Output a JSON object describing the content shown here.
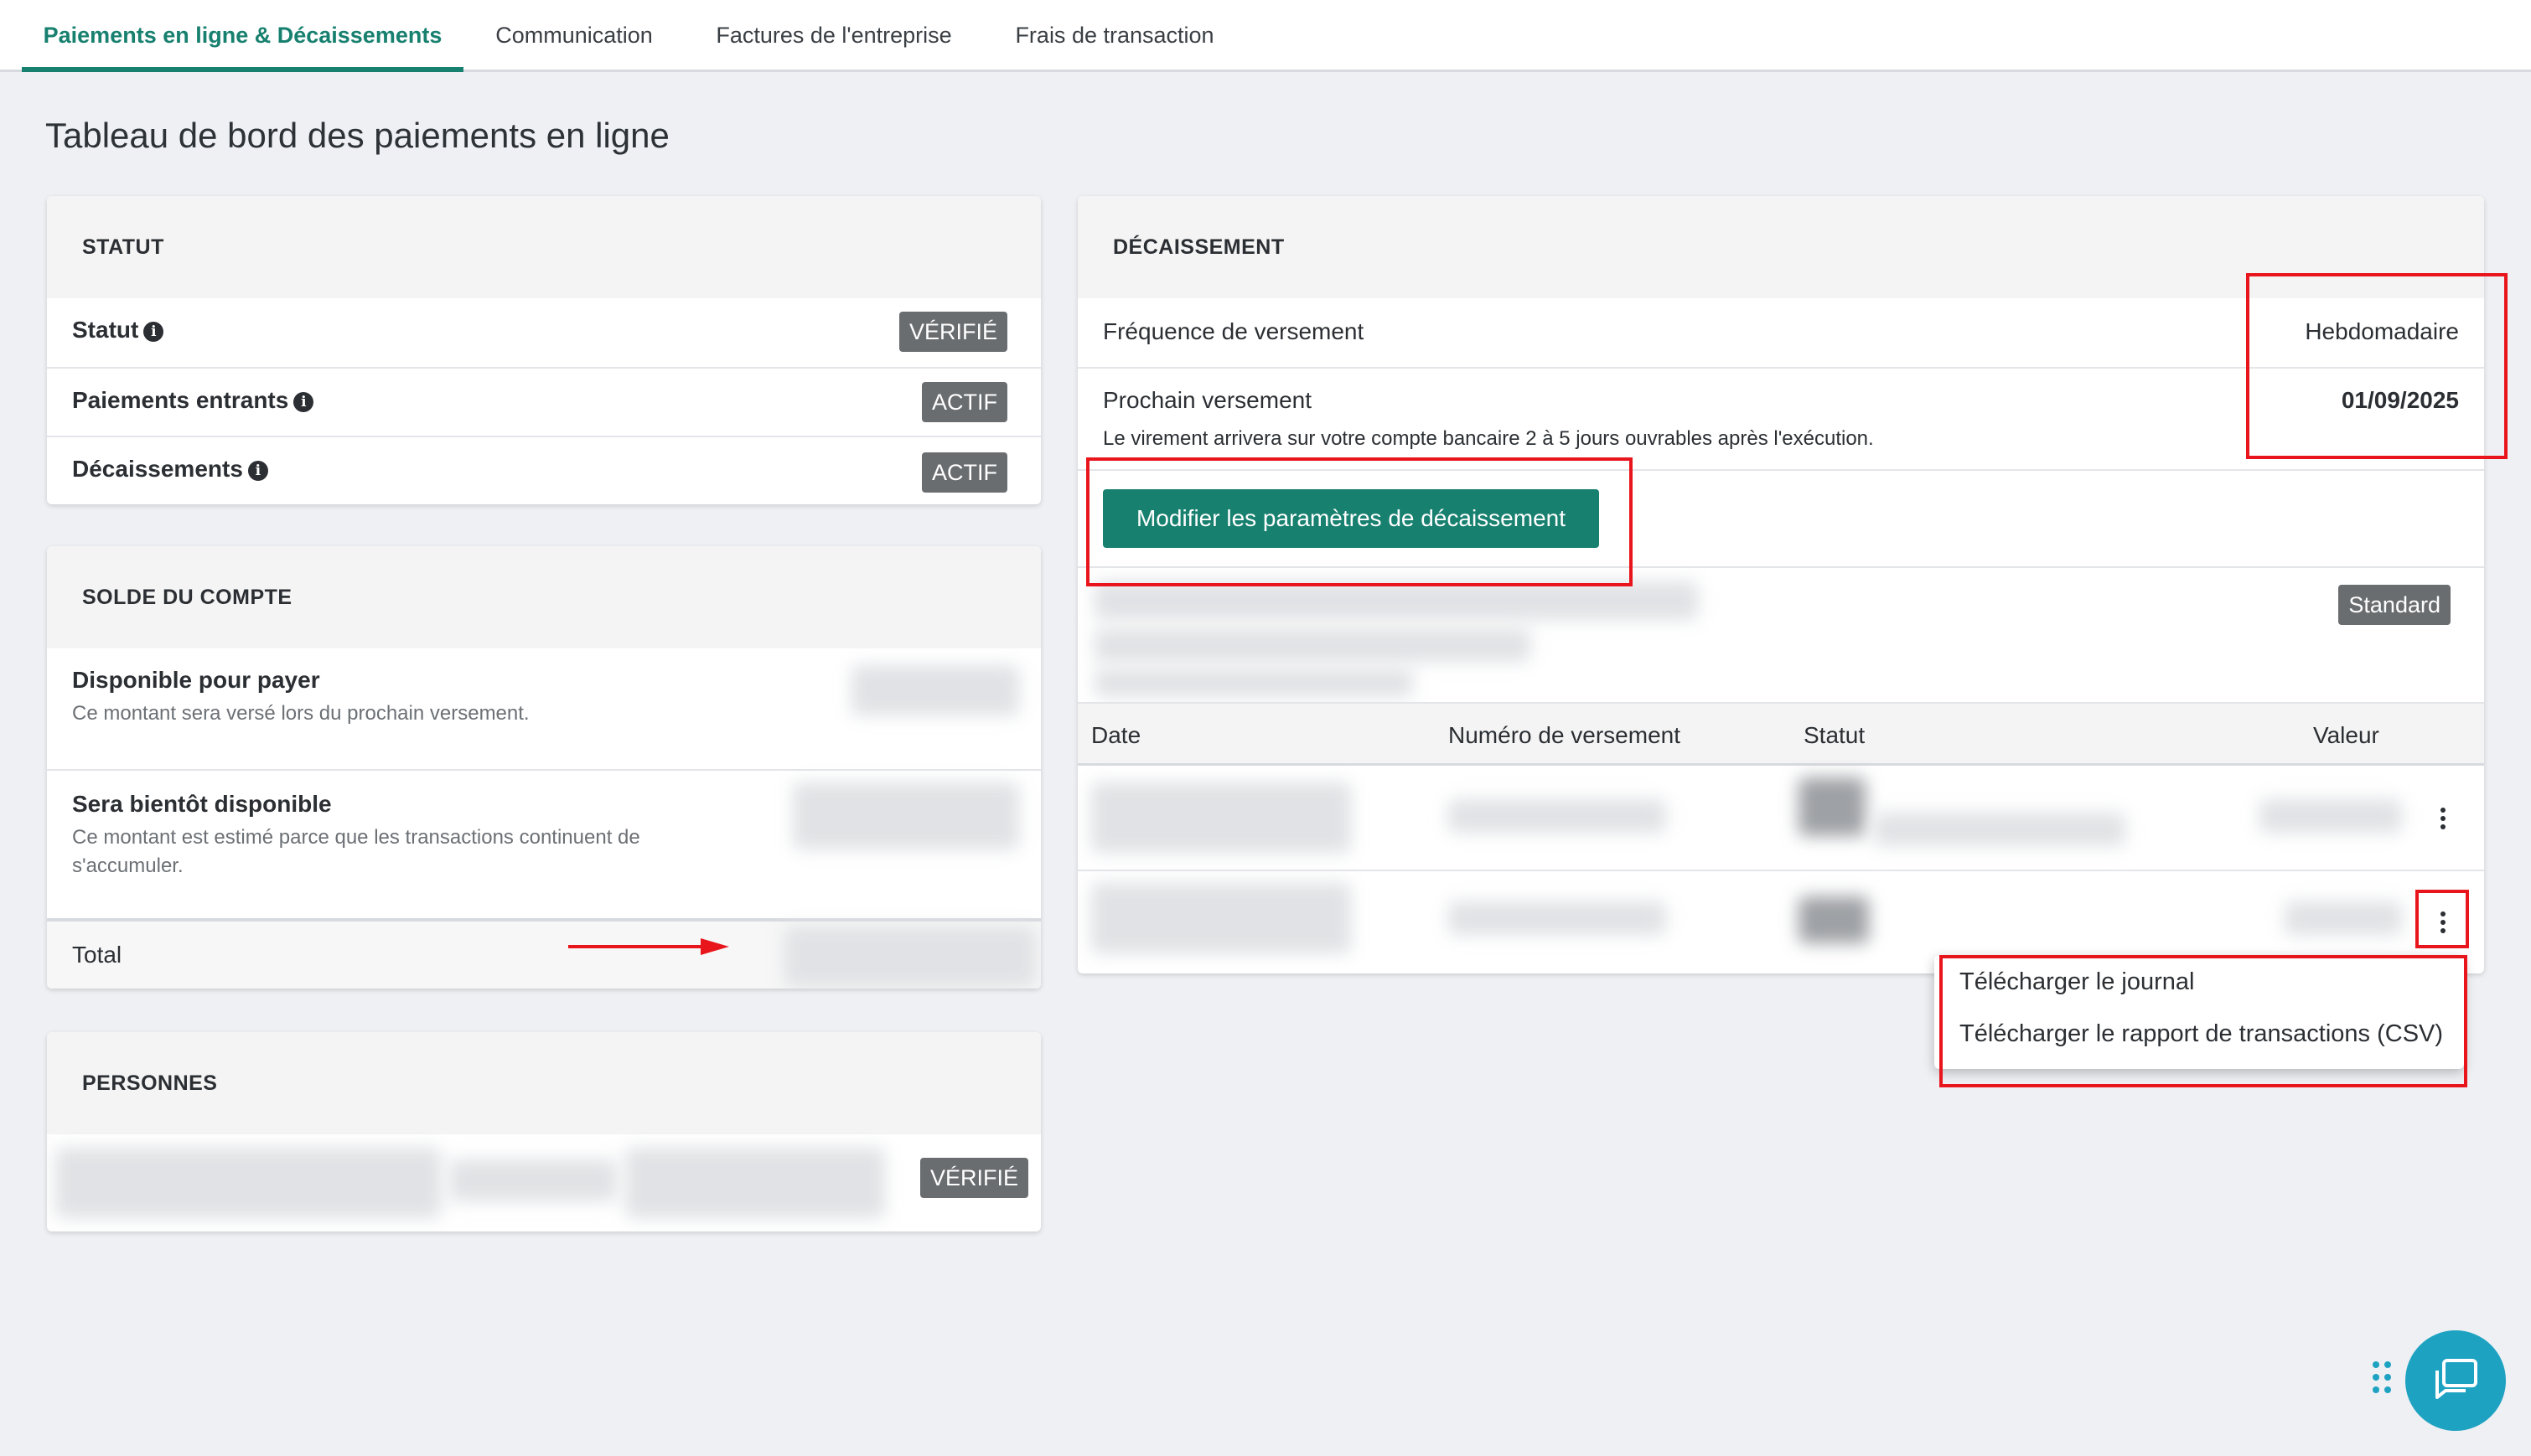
{
  "tabs": [
    {
      "label": "Paiements en ligne & Décaissements",
      "active": true
    },
    {
      "label": "Communication",
      "active": false
    },
    {
      "label": "Factures de l'entreprise",
      "active": false
    },
    {
      "label": "Frais de transaction",
      "active": false
    }
  ],
  "page_title": "Tableau de bord des paiements en ligne",
  "status_card": {
    "title": "STATUT",
    "rows": [
      {
        "label": "Statut",
        "badge": "VÉRIFIÉ"
      },
      {
        "label": "Paiements entrants",
        "badge": "ACTIF"
      },
      {
        "label": "Décaissements",
        "badge": "ACTIF"
      }
    ]
  },
  "balance_card": {
    "title": "SOLDE DU COMPTE",
    "available_label": "Disponible pour payer",
    "available_desc": "Ce montant sera versé lors du prochain versement.",
    "soon_label": "Sera bientôt disponible",
    "soon_desc_1": "Ce montant est estimé parce que les transactions continuent de",
    "soon_desc_2": "s'accumuler.",
    "total_label": "Total"
  },
  "people_card": {
    "title": "PERSONNES",
    "badge": "VÉRIFIÉ"
  },
  "payout_card": {
    "title": "DÉCAISSEMENT",
    "frequency_label": "Fréquence de versement",
    "frequency_value": "Hebdomadaire",
    "next_label": "Prochain versement",
    "next_value": "01/09/2025",
    "next_desc": "Le virement arrivera sur votre compte bancaire 2 à 5 jours ouvrables après l'exécution.",
    "modify_button": "Modifier les paramètres de décaissement",
    "account_badge": "Standard",
    "table_headers": {
      "date": "Date",
      "number": "Numéro de versement",
      "status": "Statut",
      "value": "Valeur"
    }
  },
  "row_menu": {
    "items": [
      "Télécharger le journal",
      "Télécharger le rapport de transactions (CSV)"
    ]
  },
  "colors": {
    "accent": "#17806f",
    "highlight": "#e8161c",
    "chat": "#1ea2c2"
  }
}
